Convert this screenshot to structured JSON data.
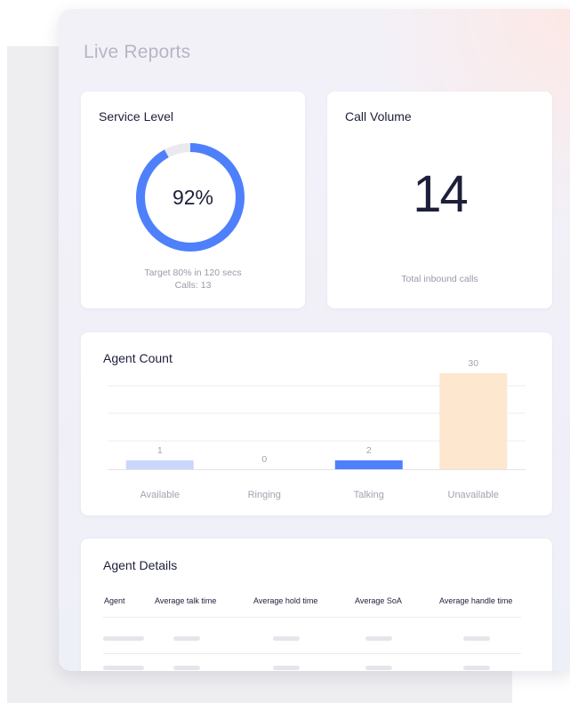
{
  "page_title": "Live Reports",
  "service_level": {
    "title": "Service Level",
    "percent": 92,
    "percent_label": "92%",
    "target_text": "Target 80% in 120 secs",
    "calls_text": "Calls: 13",
    "colors": {
      "ring": "#4f80fb",
      "track": "#e9e9ee"
    }
  },
  "call_volume": {
    "title": "Call Volume",
    "value": "14",
    "caption": "Total inbound calls"
  },
  "agent_count": {
    "title": "Agent Count"
  },
  "chart_data": {
    "type": "bar",
    "title": "Agent Count",
    "categories": [
      "Available",
      "Ringing",
      "Talking",
      "Unavailable"
    ],
    "values": [
      1,
      0,
      2,
      30
    ],
    "value_labels": [
      "1",
      "0",
      "2",
      "30"
    ],
    "colors": [
      "#c9d7fd",
      "#c9d7fd",
      "#4f80fb",
      "#fde7cf"
    ],
    "grid": true,
    "xlabel": "",
    "ylabel": ""
  },
  "agent_details": {
    "title": "Agent Details",
    "columns": [
      "Agent",
      "Average talk time",
      "Average hold time",
      "Average SoA",
      "Average handle time"
    ]
  }
}
